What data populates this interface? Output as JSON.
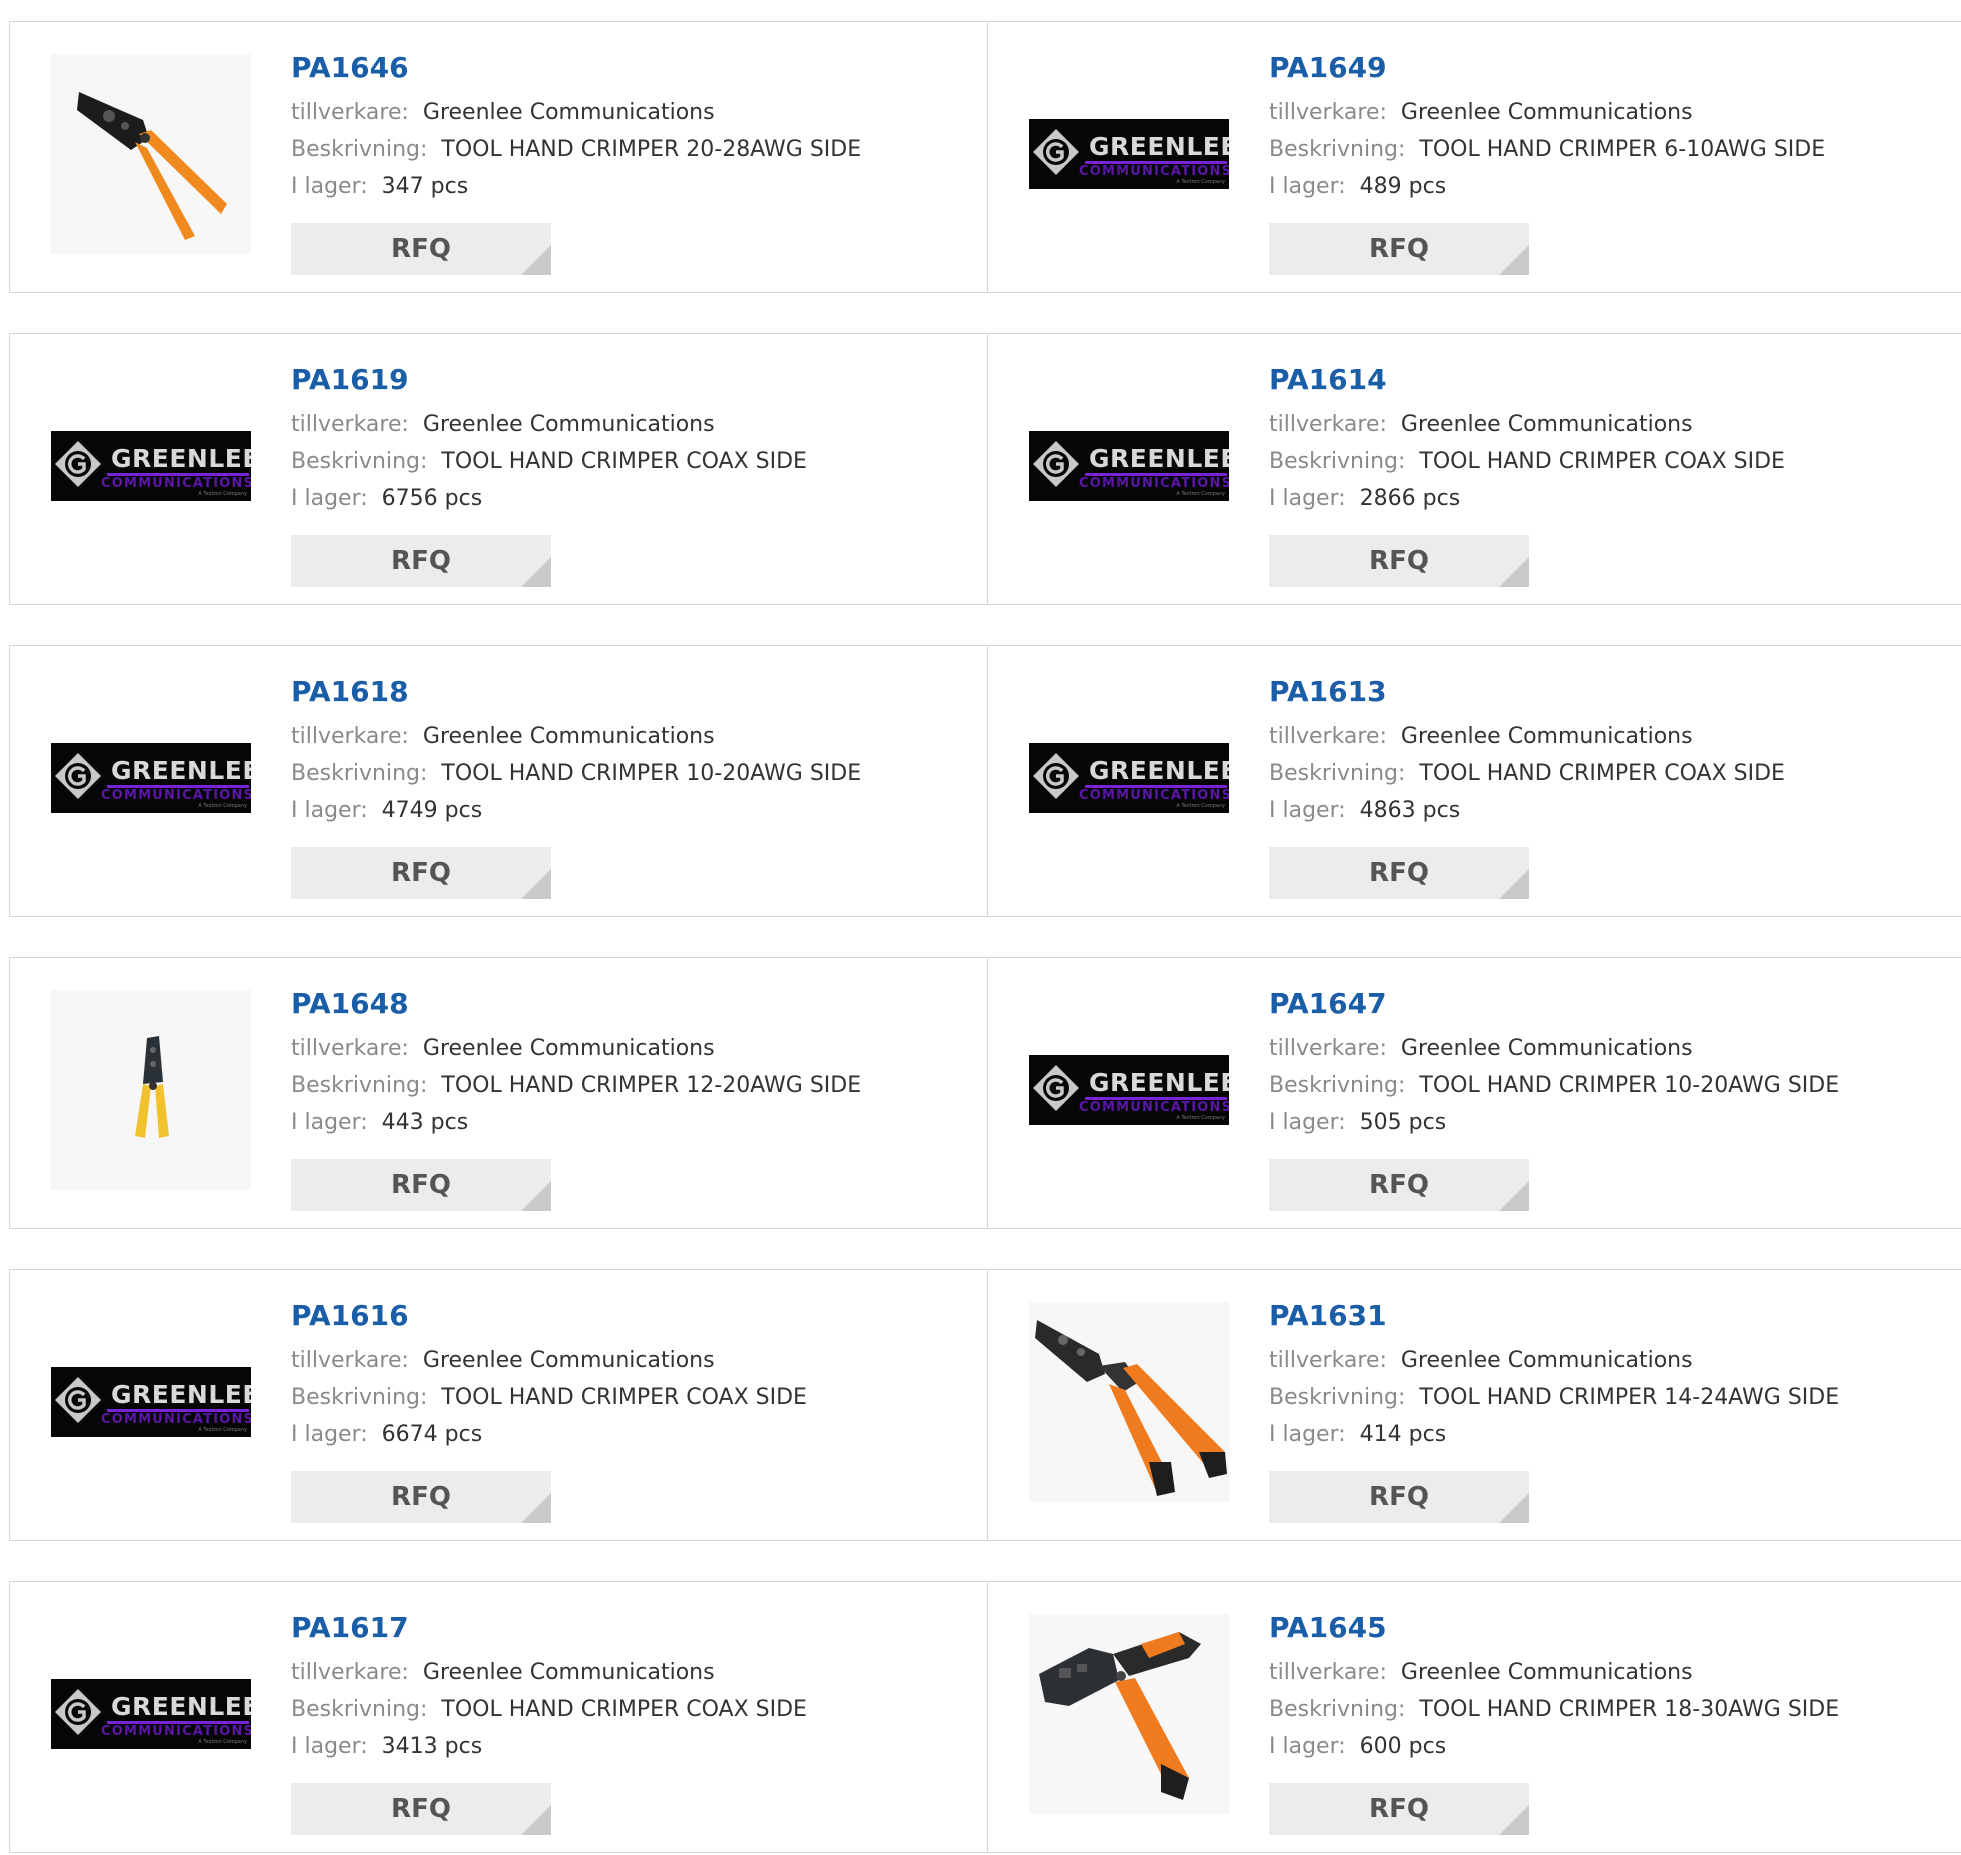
{
  "labels": {
    "manufacturer": "tillverkare:",
    "description": "Beskrivning:",
    "stock": "I lager:",
    "rfq": "RFQ"
  },
  "logo": {
    "brand": "GREENLEE.",
    "sub": "COMMUNICATIONS",
    "tiny": "A Textron Company",
    "colors": {
      "background": "#060606",
      "accent": "#7a22d6",
      "text": "#d9d9d9"
    }
  },
  "colors": {
    "part_number": "#1a5ea8",
    "label": "#8a8a8a",
    "value": "#333333",
    "button_bg": "#ececec",
    "button_text": "#555555"
  },
  "products": [
    {
      "pn": "PA1646",
      "manufacturer": "Greenlee Communications",
      "description": "TOOL HAND CRIMPER 20-28AWG SIDE",
      "stock": "347 pcs",
      "image": "orange-crimper-photo"
    },
    {
      "pn": "PA1649",
      "manufacturer": "Greenlee Communications",
      "description": "TOOL HAND CRIMPER 6-10AWG SIDE",
      "stock": "489 pcs",
      "image": "greenlee-logo"
    },
    {
      "pn": "PA1619",
      "manufacturer": "Greenlee Communications",
      "description": "TOOL HAND CRIMPER COAX SIDE",
      "stock": "6756 pcs",
      "image": "greenlee-logo"
    },
    {
      "pn": "PA1614",
      "manufacturer": "Greenlee Communications",
      "description": "TOOL HAND CRIMPER COAX SIDE",
      "stock": "2866 pcs",
      "image": "greenlee-logo"
    },
    {
      "pn": "PA1618",
      "manufacturer": "Greenlee Communications",
      "description": "TOOL HAND CRIMPER 10-20AWG SIDE",
      "stock": "4749 pcs",
      "image": "greenlee-logo"
    },
    {
      "pn": "PA1613",
      "manufacturer": "Greenlee Communications",
      "description": "TOOL HAND CRIMPER COAX SIDE",
      "stock": "4863 pcs",
      "image": "greenlee-logo"
    },
    {
      "pn": "PA1648",
      "manufacturer": "Greenlee Communications",
      "description": "TOOL HAND CRIMPER 12-20AWG SIDE",
      "stock": "443 pcs",
      "image": "yellow-crimper-photo"
    },
    {
      "pn": "PA1647",
      "manufacturer": "Greenlee Communications",
      "description": "TOOL HAND CRIMPER 10-20AWG SIDE",
      "stock": "505 pcs",
      "image": "greenlee-logo"
    },
    {
      "pn": "PA1616",
      "manufacturer": "Greenlee Communications",
      "description": "TOOL HAND CRIMPER COAX SIDE",
      "stock": "6674 pcs",
      "image": "greenlee-logo"
    },
    {
      "pn": "PA1631",
      "manufacturer": "Greenlee Communications",
      "description": "TOOL HAND CRIMPER 14-24AWG SIDE",
      "stock": "414 pcs",
      "image": "orange-black-crimper-photo"
    },
    {
      "pn": "PA1617",
      "manufacturer": "Greenlee Communications",
      "description": "TOOL HAND CRIMPER COAX SIDE",
      "stock": "3413 pcs",
      "image": "greenlee-logo"
    },
    {
      "pn": "PA1645",
      "manufacturer": "Greenlee Communications",
      "description": "TOOL HAND CRIMPER 18-30AWG SIDE",
      "stock": "600 pcs",
      "image": "ratchet-crimper-photo"
    }
  ]
}
